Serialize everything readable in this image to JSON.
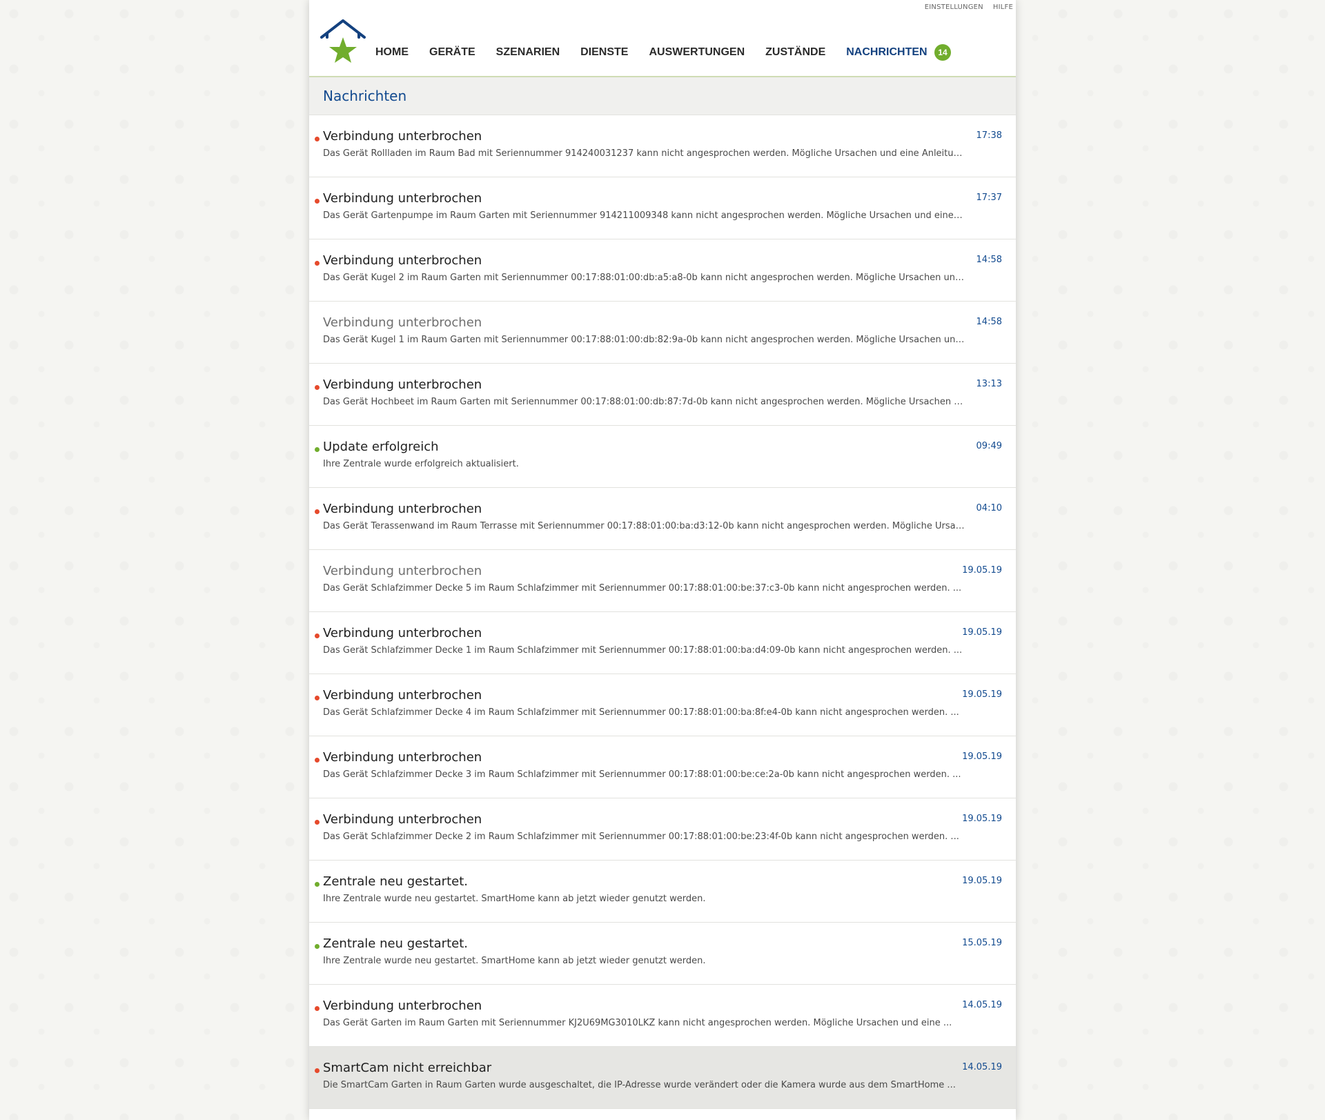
{
  "top_links": [
    "EINSTELLUNGEN",
    "HILFE"
  ],
  "nav": {
    "items": [
      "HOME",
      "GERÄTE",
      "SZENARIEN",
      "DIENSTE",
      "AUSWERTUNGEN",
      "ZUSTÄNDE"
    ],
    "active_label": "NACHRICHTEN",
    "badge_count": "14"
  },
  "colors": {
    "accent_blue": "#13417f",
    "green": "#71ad2d",
    "red": "#e64a2c"
  },
  "section_title": "Nachrichten",
  "messages": [
    {
      "title": "Verbindung unterbrochen",
      "desc": "Das Gerät Rollladen im Raum Bad mit Seriennummer 914240031237 kann nicht angesprochen werden. Mögliche Ursachen und eine Anleitun...",
      "time": "17:38",
      "status": "red",
      "muted": false
    },
    {
      "title": "Verbindung unterbrochen",
      "desc": "Das Gerät Gartenpumpe im Raum Garten mit Seriennummer 914211009348 kann nicht angesprochen werden. Mögliche Ursachen und eine ...",
      "time": "17:37",
      "status": "red",
      "muted": false
    },
    {
      "title": "Verbindung unterbrochen",
      "desc": "Das Gerät Kugel 2 im Raum Garten mit Seriennummer 00:17:88:01:00:db:a5:a8-0b kann nicht angesprochen werden. Mögliche Ursachen und ...",
      "time": "14:58",
      "status": "red",
      "muted": false
    },
    {
      "title": "Verbindung unterbrochen",
      "desc": "Das Gerät Kugel 1 im Raum Garten mit Seriennummer 00:17:88:01:00:db:82:9a-0b kann nicht angesprochen werden. Mögliche Ursachen und ...",
      "time": "14:58",
      "status": "none",
      "muted": true
    },
    {
      "title": "Verbindung unterbrochen",
      "desc": "Das Gerät Hochbeet im Raum Garten mit Seriennummer 00:17:88:01:00:db:87:7d-0b kann nicht angesprochen werden. Mögliche Ursachen u...",
      "time": "13:13",
      "status": "red",
      "muted": false
    },
    {
      "title": "Update erfolgreich",
      "desc": "Ihre Zentrale wurde erfolgreich aktualisiert.",
      "time": "09:49",
      "status": "green",
      "muted": false
    },
    {
      "title": "Verbindung unterbrochen",
      "desc": "Das Gerät Terassenwand im Raum Terrasse mit Seriennummer 00:17:88:01:00:ba:d3:12-0b kann nicht angesprochen werden. Mögliche Ursac...",
      "time": "04:10",
      "status": "red",
      "muted": false
    },
    {
      "title": "Verbindung unterbrochen",
      "desc": "Das Gerät Schlafzimmer Decke 5 im Raum Schlafzimmer mit Seriennummer 00:17:88:01:00:be:37:c3-0b kann nicht angesprochen werden. ...",
      "time": "19.05.19",
      "status": "none",
      "muted": true
    },
    {
      "title": "Verbindung unterbrochen",
      "desc": "Das Gerät Schlafzimmer Decke 1 im Raum Schlafzimmer mit Seriennummer 00:17:88:01:00:ba:d4:09-0b kann nicht angesprochen werden. ...",
      "time": "19.05.19",
      "status": "red",
      "muted": false
    },
    {
      "title": "Verbindung unterbrochen",
      "desc": "Das Gerät Schlafzimmer Decke 4 im Raum Schlafzimmer mit Seriennummer 00:17:88:01:00:ba:8f:e4-0b kann nicht angesprochen werden. ...",
      "time": "19.05.19",
      "status": "red",
      "muted": false
    },
    {
      "title": "Verbindung unterbrochen",
      "desc": "Das Gerät Schlafzimmer Decke 3 im Raum Schlafzimmer mit Seriennummer 00:17:88:01:00:be:ce:2a-0b kann nicht angesprochen werden. ...",
      "time": "19.05.19",
      "status": "red",
      "muted": false
    },
    {
      "title": "Verbindung unterbrochen",
      "desc": "Das Gerät Schlafzimmer Decke 2 im Raum Schlafzimmer mit Seriennummer 00:17:88:01:00:be:23:4f-0b kann nicht angesprochen werden. ...",
      "time": "19.05.19",
      "status": "red",
      "muted": false
    },
    {
      "title": "Zentrale neu gestartet.",
      "desc": "Ihre Zentrale wurde neu gestartet. SmartHome kann ab jetzt wieder genutzt werden.",
      "time": "19.05.19",
      "status": "green",
      "muted": false
    },
    {
      "title": "Zentrale neu gestartet.",
      "desc": "Ihre Zentrale wurde neu gestartet. SmartHome kann ab jetzt wieder genutzt werden.",
      "time": "15.05.19",
      "status": "green",
      "muted": false
    },
    {
      "title": "Verbindung unterbrochen",
      "desc": "Das Gerät Garten im Raum Garten mit Seriennummer KJ2U69MG3010LKZ kann nicht angesprochen werden. Mögliche Ursachen und eine ...",
      "time": "14.05.19",
      "status": "red",
      "muted": false
    },
    {
      "title": "SmartCam nicht erreichbar",
      "desc": "Die SmartCam Garten in Raum Garten wurde ausgeschaltet, die IP-Adresse wurde verändert oder die Kamera wurde aus dem SmartHome ...",
      "time": "14.05.19",
      "status": "red",
      "muted": false,
      "highlight": true
    }
  ]
}
